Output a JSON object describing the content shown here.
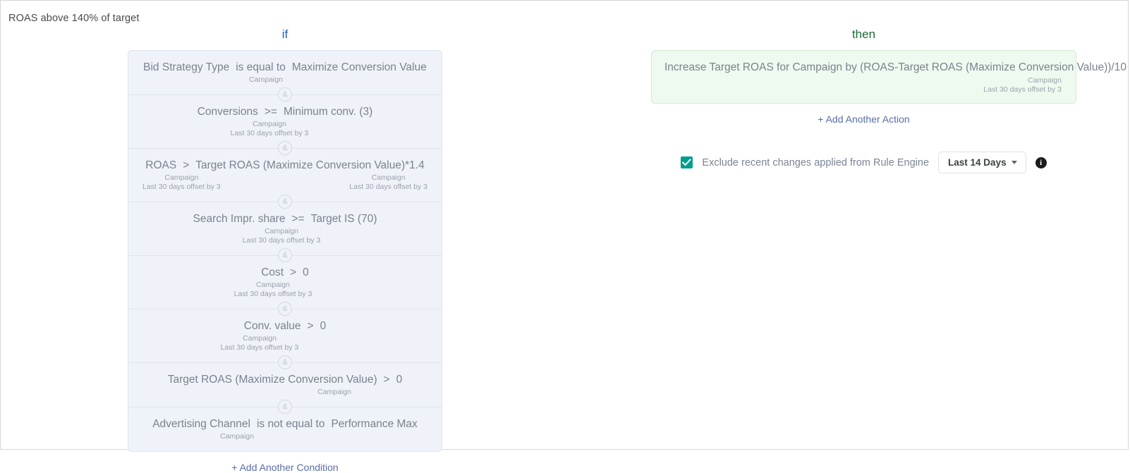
{
  "rule": {
    "title": "ROAS above 140% of target"
  },
  "if_section": {
    "heading": "if",
    "add_link": "+ Add Another Condition",
    "conditions": [
      {
        "field": "Bid Strategy Type",
        "operator": "is equal to",
        "value": "Maximize Conversion Value",
        "field_subs": [
          "Campaign"
        ],
        "value_subs": [],
        "sub_layout": "center",
        "nudge": "nudge-a"
      },
      {
        "field": "Conversions",
        "operator": ">=",
        "value": "Minimum conv. (3)",
        "field_subs": [
          "Campaign",
          "Last 30 days offset by 3"
        ],
        "value_subs": [],
        "sub_layout": "center",
        "nudge": "nudge-b"
      },
      {
        "field": "ROAS",
        "operator": ">",
        "value": "Target ROAS (Maximize Conversion Value)*1.4",
        "field_subs": [
          "Campaign",
          "Last 30 days offset by 3"
        ],
        "value_subs": [
          "Campaign",
          "Last 30 days offset by 3"
        ],
        "sub_layout": "split",
        "nudge": ""
      },
      {
        "field": "Search Impr. share",
        "operator": ">=",
        "value": "Target IS (70)",
        "field_subs": [
          "Campaign",
          "Last 30 days offset by 3"
        ],
        "value_subs": [],
        "sub_layout": "center",
        "nudge": "nudge-c"
      },
      {
        "field": "Cost",
        "operator": ">",
        "value": "0",
        "field_subs": [
          "Campaign",
          "Last 30 days offset by 3"
        ],
        "value_subs": [],
        "sub_layout": "center",
        "nudge": "nudge-d"
      },
      {
        "field": "Conv. value",
        "operator": ">",
        "value": "0",
        "field_subs": [
          "Campaign",
          "Last 30 days offset by 3"
        ],
        "value_subs": [],
        "sub_layout": "center",
        "nudge": "nudge-e"
      },
      {
        "field": "Target ROAS (Maximize Conversion Value)",
        "operator": ">",
        "value": "0",
        "field_subs": [
          "Campaign"
        ],
        "value_subs": [],
        "sub_layout": "center",
        "nudge": "nudge-f"
      },
      {
        "field": "Advertising Channel",
        "operator": "is not equal to",
        "value": "Performance Max",
        "field_subs": [
          "Campaign"
        ],
        "value_subs": [],
        "sub_layout": "center",
        "nudge": "nudge-g"
      }
    ],
    "connector_label": "&"
  },
  "then_section": {
    "heading": "then",
    "add_link": "+ Add Another Action",
    "action": {
      "text": "Increase Target ROAS for Campaign by (ROAS-Target ROAS (Maximize Conversion Value))/10",
      "subs": [
        "Campaign",
        "Last 30 days offset by 3"
      ]
    },
    "exclude": {
      "label": "Exclude recent changes applied from Rule Engine",
      "checked": true,
      "range_value": "Last 14 Days",
      "info_glyph": "i"
    }
  },
  "colors": {
    "if_heading": "#1a5fb4",
    "then_heading": "#1c6b36",
    "condition_bg": "#eff2f8",
    "action_bg": "#eefaef",
    "checkbox": "#009e8e",
    "link": "#5a6ea8"
  }
}
